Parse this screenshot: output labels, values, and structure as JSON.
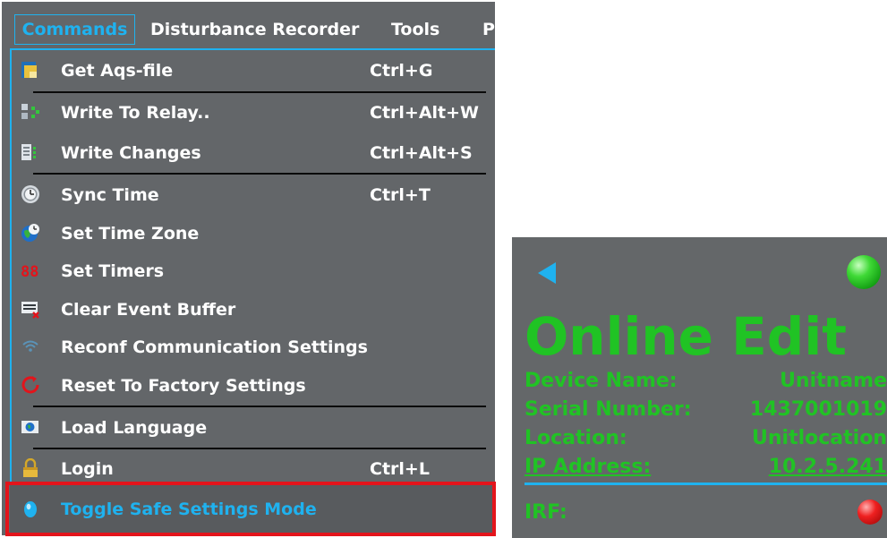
{
  "menubar": {
    "items": [
      "Commands",
      "Disturbance Recorder",
      "Tools",
      "P"
    ]
  },
  "commands_menu": {
    "items": [
      {
        "label": "Get Aqs-file",
        "shortcut": "Ctrl+G",
        "icon": "get-aqs-file-icon"
      },
      {
        "label": "Write To Relay..",
        "shortcut": "Ctrl+Alt+W",
        "icon": "write-to-relay-icon"
      },
      {
        "label": "Write Changes",
        "shortcut": "Ctrl+Alt+S",
        "icon": "write-changes-icon"
      },
      {
        "label": "Sync Time",
        "shortcut": "Ctrl+T",
        "icon": "clock-icon"
      },
      {
        "label": "Set Time Zone",
        "shortcut": "",
        "icon": "globe-clock-icon"
      },
      {
        "label": "Set Timers",
        "shortcut": "",
        "icon": "timer-digits-icon"
      },
      {
        "label": "Clear Event Buffer",
        "shortcut": "",
        "icon": "clear-buffer-icon"
      },
      {
        "label": "Reconf Communication Settings",
        "shortcut": "",
        "icon": "wifi-icon"
      },
      {
        "label": "Reset To Factory Settings",
        "shortcut": "",
        "icon": "reset-icon"
      },
      {
        "label": "Load Language",
        "shortcut": "",
        "icon": "language-icon"
      },
      {
        "label": "Login",
        "shortcut": "Ctrl+L",
        "icon": "lock-icon"
      },
      {
        "label": "Toggle Safe Settings Mode",
        "shortcut": "",
        "icon": "drop-icon"
      }
    ],
    "highlight_color": "#e3141b",
    "accent_color": "#1fb2ef"
  },
  "status_panel": {
    "title": "Online Edit",
    "rows": [
      {
        "label": "Device Name:",
        "value": "Unitname"
      },
      {
        "label": "Serial Number:",
        "value": "1437001019"
      },
      {
        "label": "Location:",
        "value": "Unitlocation"
      },
      {
        "label": "IP Address:",
        "value": "10.2.5.241"
      }
    ],
    "irf_label": "IRF:",
    "status_led": "green",
    "irf_led": "red",
    "text_color": "#20c324"
  }
}
